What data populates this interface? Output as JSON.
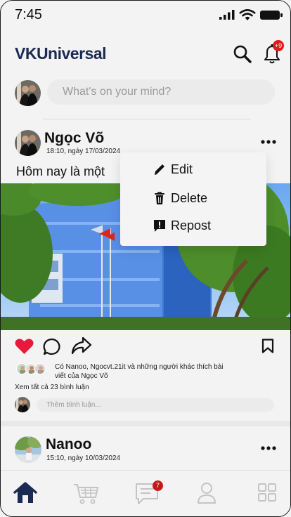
{
  "status_bar": {
    "time": "7:45"
  },
  "header": {
    "logo": "VKUniversal",
    "notification_count": "+9"
  },
  "composer": {
    "placeholder": "What's on your mind?"
  },
  "posts": [
    {
      "author": "Ngọc Võ",
      "time": "18:10, ngày 17/03/2024",
      "text": "Hôm nay là một",
      "liked": true,
      "likes_text": "Có Nanoo, Ngocvt.21it và những người khác thích bài viết của Ngọc Võ",
      "view_comments": "Xem tất cả 23 bình luận",
      "comment_placeholder": "Thêm bình luận..."
    },
    {
      "author": "Nanoo",
      "time": "15:10, ngày 10/03/2024"
    }
  ],
  "post_menu": {
    "items": [
      "Edit",
      "Delete",
      "Repost"
    ]
  },
  "bottom_nav": {
    "items": [
      "home-icon",
      "cart-icon",
      "chat-icon",
      "profile-icon",
      "grid-icon"
    ],
    "active": "home-icon",
    "chat_badge": "7"
  },
  "colors": {
    "brand": "#1a2a52",
    "like": "#e8193c",
    "badge": "#e01b1b"
  }
}
